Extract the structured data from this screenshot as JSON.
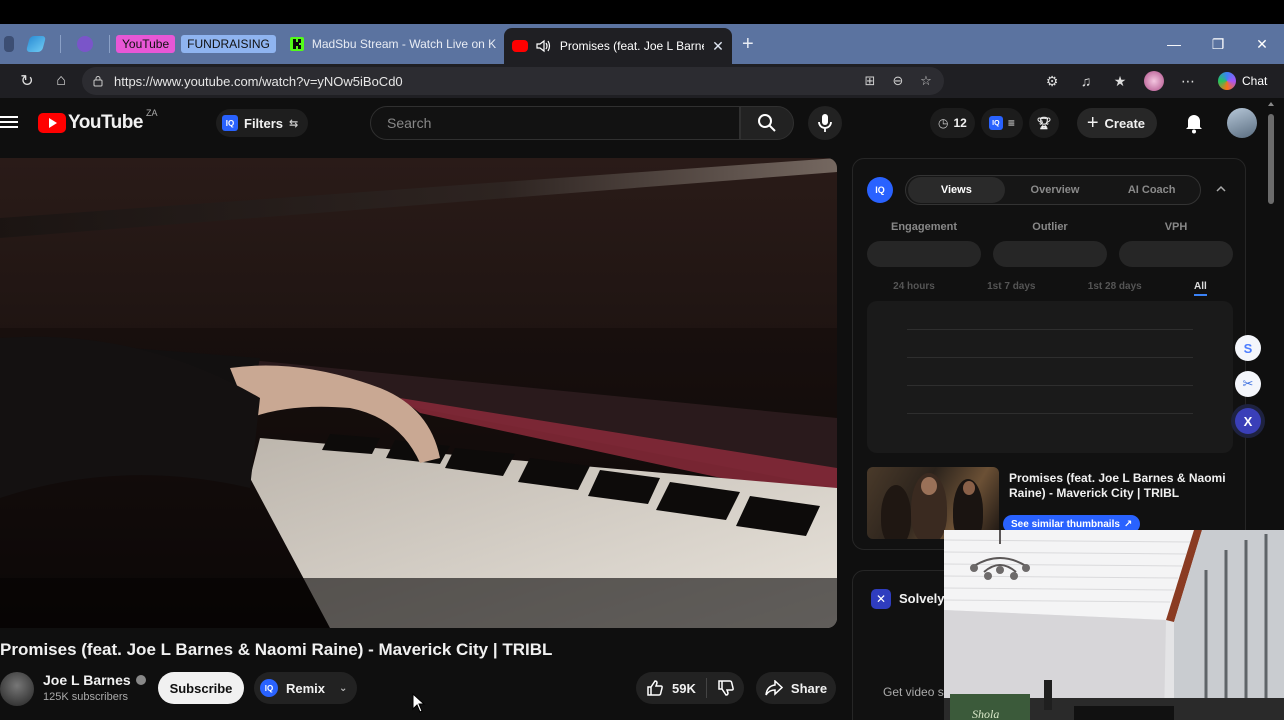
{
  "browser": {
    "tab_groups": [
      "YouTube",
      "FUNDRAISING"
    ],
    "tabs": [
      {
        "title": "MadSbu Stream - Watch Live on K"
      },
      {
        "title": "Promises (feat. Joe L Barnes &"
      }
    ],
    "url": "https://www.youtube.com/watch?v=yNOw5iBoCd0",
    "chat_label": "Chat"
  },
  "youtube": {
    "logo_text": "YouTube",
    "country_code": "ZA",
    "filters_label": "Filters",
    "search_placeholder": "Search",
    "iq_badge": "IQ",
    "timer_count": "12",
    "create_label": "Create"
  },
  "video": {
    "title": "Promises (feat. Joe L Barnes & Naomi Raine) - Maverick City | TRIBL",
    "channel": "Joe L Barnes",
    "subscribers": "125K subscribers",
    "subscribe_label": "Subscribe",
    "remix_label": "Remix",
    "likes": "59K",
    "share_label": "Share"
  },
  "iq_panel": {
    "logo": "IQ",
    "tabs": [
      "Views",
      "Overview",
      "AI Coach"
    ],
    "active_tab": "Views",
    "metrics": [
      "Engagement",
      "Outlier",
      "VPH"
    ],
    "ranges": [
      "24 hours",
      "1st 7 days",
      "1st 28 days",
      "All"
    ],
    "active_range": "All",
    "thumb_title": "Promises (feat. Joe L Barnes & Naomi Raine) - Maverick City | TRIBL",
    "similar_label": "See similar thumbnails"
  },
  "solvely": {
    "name": "Solvely.",
    "hint": "Get video s"
  },
  "side_buttons": [
    "S",
    "✂",
    "X"
  ],
  "webcam": {
    "caption": "Shola"
  },
  "colors": {
    "youtube_red": "#ff0000",
    "iq_blue": "#2962ff",
    "tabbar": "#5b73a0"
  }
}
